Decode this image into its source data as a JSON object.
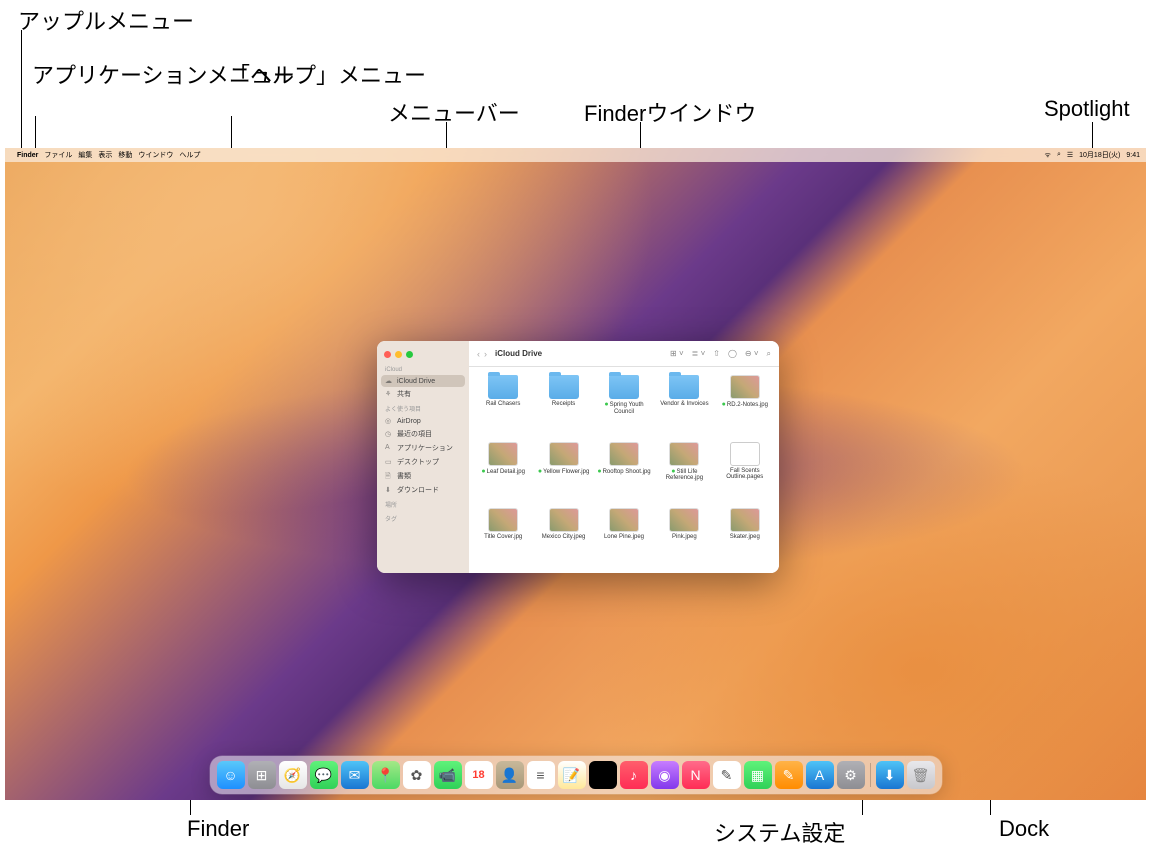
{
  "annotations": {
    "apple_menu": "アップルメニュー",
    "app_menu": "アプリケーションメニュー",
    "help_menu": "「ヘルプ」メニュー",
    "menu_bar": "メニューバー",
    "finder_window": "Finderウインドウ",
    "spotlight": "Spotlight",
    "finder": "Finder",
    "system_settings": "システム設定",
    "dock": "Dock"
  },
  "menubar": {
    "app_name": "Finder",
    "items": [
      "ファイル",
      "編集",
      "表示",
      "移動",
      "ウインドウ",
      "ヘルプ"
    ],
    "date": "10月18日(火)",
    "time": "9:41"
  },
  "finder_window": {
    "title": "iCloud Drive",
    "sidebar": {
      "section_icloud": "iCloud",
      "icloud_drive": "iCloud Drive",
      "shared": "共有",
      "section_fav": "よく使う項目",
      "airdrop": "AirDrop",
      "recents": "最近の項目",
      "applications": "アプリケーション",
      "desktop": "デスクトップ",
      "documents": "書類",
      "downloads": "ダウンロード",
      "section_loc": "場所",
      "section_tag": "タグ"
    },
    "files": [
      {
        "name": "Rail Chasers",
        "type": "folder",
        "synced": false
      },
      {
        "name": "Receipts",
        "type": "folder",
        "synced": false
      },
      {
        "name": "Spring Youth Council",
        "type": "folder",
        "synced": true
      },
      {
        "name": "Vendor & Invoices",
        "type": "folder",
        "synced": false
      },
      {
        "name": "RD.2-Notes.jpg",
        "type": "img",
        "synced": true
      },
      {
        "name": "Leaf Detail.jpg",
        "type": "img",
        "synced": true
      },
      {
        "name": "Yellow Flower.jpg",
        "type": "img",
        "synced": true
      },
      {
        "name": "Rooftop Shoot.jpg",
        "type": "img",
        "synced": true
      },
      {
        "name": "Still Life Reference.jpg",
        "type": "img",
        "synced": true
      },
      {
        "name": "Fall Scents Outline.pages",
        "type": "doc",
        "synced": false
      },
      {
        "name": "Title Cover.jpg",
        "type": "img",
        "synced": false
      },
      {
        "name": "Mexico City.jpeg",
        "type": "img",
        "synced": false
      },
      {
        "name": "Lone Pine.jpeg",
        "type": "img",
        "synced": false
      },
      {
        "name": "Pink.jpeg",
        "type": "img",
        "synced": false
      },
      {
        "name": "Skater.jpeg",
        "type": "img",
        "synced": false
      }
    ]
  },
  "dock": {
    "items": [
      {
        "name": "finder",
        "bg": "linear-gradient(#5ac8fa,#1e90ff)",
        "glyph": "☺"
      },
      {
        "name": "launchpad",
        "bg": "linear-gradient(#b0b0b5,#8e8e93)",
        "glyph": "⊞"
      },
      {
        "name": "safari",
        "bg": "linear-gradient(#fff,#e6e6e6)",
        "glyph": "🧭"
      },
      {
        "name": "messages",
        "bg": "linear-gradient(#5ff27a,#30d158)",
        "glyph": "💬"
      },
      {
        "name": "mail",
        "bg": "linear-gradient(#4fc3f7,#1976d2)",
        "glyph": "✉"
      },
      {
        "name": "maps",
        "bg": "linear-gradient(#a5e887,#4cd964)",
        "glyph": "📍"
      },
      {
        "name": "photos",
        "bg": "#fff",
        "glyph": "✿"
      },
      {
        "name": "facetime",
        "bg": "linear-gradient(#5ff27a,#30d158)",
        "glyph": "📹"
      },
      {
        "name": "calendar",
        "bg": "#fff",
        "glyph": "18"
      },
      {
        "name": "contacts",
        "bg": "linear-gradient(#c8b89a,#a89878)",
        "glyph": "👤"
      },
      {
        "name": "reminders",
        "bg": "#fff",
        "glyph": "≡"
      },
      {
        "name": "notes",
        "bg": "linear-gradient(#fff,#ffe89a)",
        "glyph": "📝"
      },
      {
        "name": "tv",
        "bg": "#000",
        "glyph": ""
      },
      {
        "name": "music",
        "bg": "linear-gradient(#ff5e6c,#ff2d55)",
        "glyph": "♪"
      },
      {
        "name": "podcasts",
        "bg": "linear-gradient(#c77dff,#8338ec)",
        "glyph": "◉"
      },
      {
        "name": "news",
        "bg": "linear-gradient(#ff6b8a,#ff2d55)",
        "glyph": "N"
      },
      {
        "name": "freeform",
        "bg": "#fff",
        "glyph": "✎"
      },
      {
        "name": "numbers",
        "bg": "linear-gradient(#5ff27a,#30d158)",
        "glyph": "▦"
      },
      {
        "name": "pages",
        "bg": "linear-gradient(#ffb347,#ff8c00)",
        "glyph": "✎"
      },
      {
        "name": "appstore",
        "bg": "linear-gradient(#4fc3f7,#1976d2)",
        "glyph": "A"
      },
      {
        "name": "system-settings",
        "bg": "linear-gradient(#b0b0b5,#8e8e93)",
        "glyph": "⚙"
      }
    ],
    "right": [
      {
        "name": "downloads",
        "bg": "linear-gradient(#4fc3f7,#1976d2)",
        "glyph": "⬇"
      },
      {
        "name": "trash",
        "bg": "linear-gradient(#e8e8ec,#c8c8cc)",
        "glyph": "🗑"
      }
    ]
  }
}
